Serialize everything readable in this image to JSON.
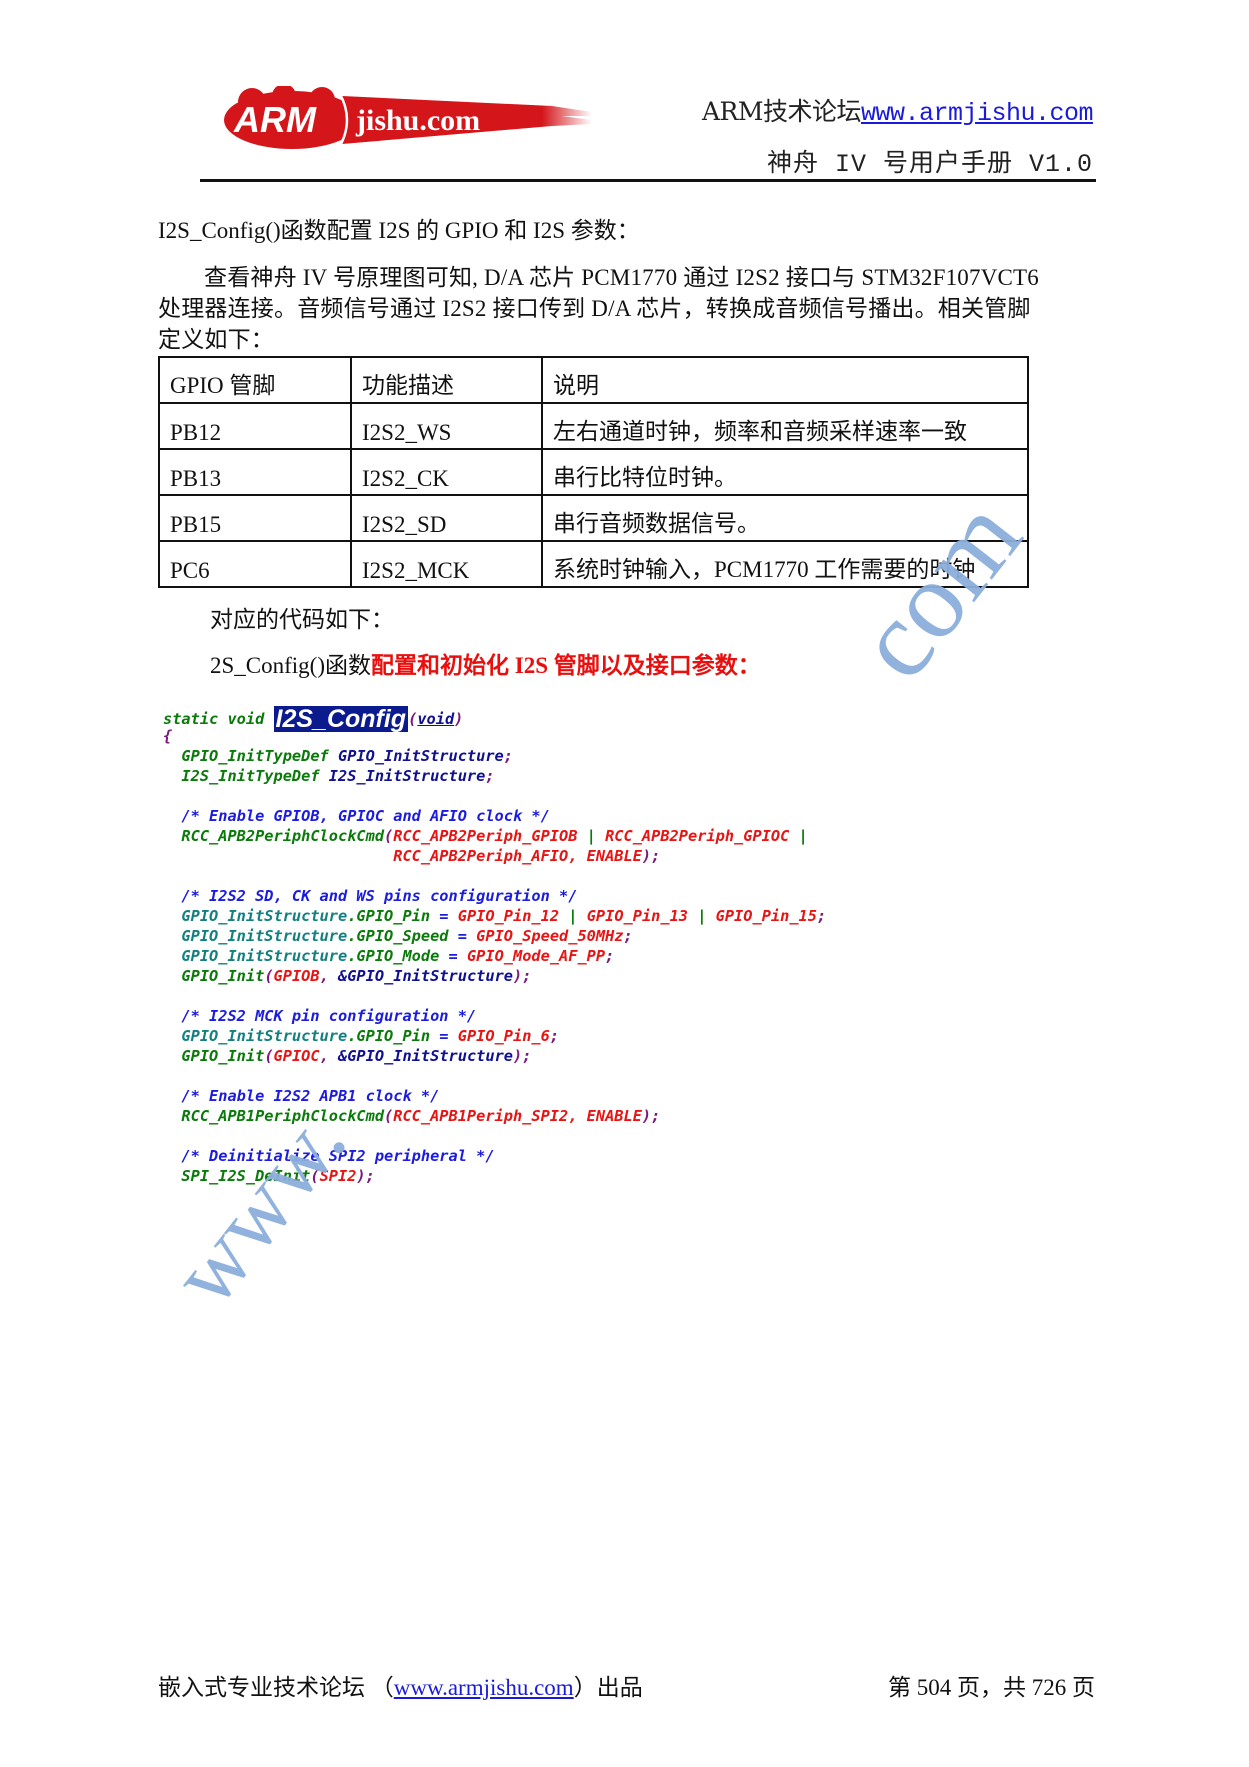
{
  "header": {
    "logo_text_arm": "ARM",
    "logo_text_site": "jishu.com",
    "forum_label": "ARM技术论坛",
    "forum_url": "www.armjishu.com",
    "manual_title": "神舟 IV 号用户手册 V1.0"
  },
  "body": {
    "heading": "I2S_Config()函数配置 I2S 的 GPIO 和 I2S 参数：",
    "intro_lines": [
      "查看神舟 IV 号原理图可知, D/A 芯片 PCM1770 通过 I2S2 接口与 STM32F107VCT6",
      "处理器连接。音频信号通过 I2S2 接口传到 D/A 芯片，转换成音频信号播出。相关管脚",
      "定义如下："
    ],
    "code_intro": "对应的代码如下：",
    "code_caption_plain": "2S_Config()函数",
    "code_caption_red": "配置和初始化 I2S 管脚以及接口参数："
  },
  "table": {
    "headers": [
      "GPIO 管脚",
      "功能描述",
      "说明"
    ],
    "rows": [
      [
        "PB12",
        "I2S2_WS",
        "左右通道时钟，频率和音频采样速率一致"
      ],
      [
        "PB13",
        "I2S2_CK",
        "串行比特位时钟。"
      ],
      [
        "PB15",
        "I2S2_SD",
        "串行音频数据信号。"
      ],
      [
        "PC6",
        "I2S2_MCK",
        "系统时钟输入，PCM1770 工作需要的时钟"
      ]
    ]
  },
  "code": [
    [
      [
        "static void ",
        "green"
      ],
      [
        "I2S_Config",
        "fn"
      ],
      [
        "(",
        "purple"
      ],
      [
        "void",
        "uline"
      ],
      [
        ")",
        "purple"
      ]
    ],
    [
      [
        "{",
        "purple"
      ]
    ],
    [
      [
        "  GPIO_InitTypeDef ",
        "green"
      ],
      [
        "GPIO_InitStructure",
        "navy"
      ],
      [
        ";",
        "purple"
      ]
    ],
    [
      [
        "  I2S_InitTypeDef ",
        "green"
      ],
      [
        "I2S_InitStructure",
        "navy"
      ],
      [
        ";",
        "purple"
      ]
    ],
    [],
    [
      [
        "  /* Enable GPIOB, GPIOC and AFIO clock */",
        "blue"
      ]
    ],
    [
      [
        "  RCC_APB2PeriphClockCmd",
        "green"
      ],
      [
        "(",
        "purple"
      ],
      [
        "RCC_APB2Periph_GPIOB",
        "red"
      ],
      [
        " | ",
        "green"
      ],
      [
        "RCC_APB2Periph_GPIOC",
        "red"
      ],
      [
        " |",
        "green"
      ]
    ],
    [
      [
        "                         ",
        "green"
      ],
      [
        "RCC_APB2Periph_AFIO, ENABLE",
        "red"
      ],
      [
        ");",
        "purple"
      ]
    ],
    [],
    [
      [
        "  /* I2S2 SD, CK and WS pins configuration */",
        "blue"
      ]
    ],
    [
      [
        "  GPIO_InitStructure",
        "teal"
      ],
      [
        ".GPIO_Pin",
        "green"
      ],
      [
        " = ",
        "blue"
      ],
      [
        "GPIO_Pin_12",
        "red"
      ],
      [
        " | ",
        "green"
      ],
      [
        "GPIO_Pin_13",
        "red"
      ],
      [
        " | ",
        "green"
      ],
      [
        "GPIO_Pin_15",
        "red"
      ],
      [
        ";",
        "purple"
      ]
    ],
    [
      [
        "  GPIO_InitStructure",
        "teal"
      ],
      [
        ".GPIO_Speed",
        "green"
      ],
      [
        " = ",
        "blue"
      ],
      [
        "GPIO_Speed_50MHz",
        "red"
      ],
      [
        ";",
        "purple"
      ]
    ],
    [
      [
        "  GPIO_InitStructure",
        "teal"
      ],
      [
        ".GPIO_Mode",
        "green"
      ],
      [
        " = ",
        "blue"
      ],
      [
        "GPIO_Mode_AF_PP",
        "red"
      ],
      [
        ";",
        "purple"
      ]
    ],
    [
      [
        "  GPIO_Init",
        "green"
      ],
      [
        "(",
        "purple"
      ],
      [
        "GPIOB",
        "red"
      ],
      [
        ", ",
        "purple"
      ],
      [
        "&GPIO_InitStructure",
        "navy"
      ],
      [
        ");",
        "purple"
      ]
    ],
    [],
    [
      [
        "  /* I2S2 MCK pin configuration */",
        "blue"
      ]
    ],
    [
      [
        "  GPIO_InitStructure",
        "teal"
      ],
      [
        ".GPIO_Pin",
        "green"
      ],
      [
        " = ",
        "blue"
      ],
      [
        "GPIO_Pin_6",
        "red"
      ],
      [
        ";",
        "purple"
      ]
    ],
    [
      [
        "  GPIO_Init",
        "green"
      ],
      [
        "(",
        "purple"
      ],
      [
        "GPIOC",
        "red"
      ],
      [
        ", ",
        "purple"
      ],
      [
        "&GPIO_InitStructure",
        "navy"
      ],
      [
        ");",
        "purple"
      ]
    ],
    [],
    [
      [
        "  /* Enable I2S2 APB1 clock */",
        "blue"
      ]
    ],
    [
      [
        "  RCC_APB1PeriphClockCmd",
        "green"
      ],
      [
        "(",
        "purple"
      ],
      [
        "RCC_APB1Periph_SPI2, ENABLE",
        "red"
      ],
      [
        ");",
        "purple"
      ]
    ],
    [],
    [
      [
        "  /* Deinitialize SPI2 peripheral */",
        "blue"
      ]
    ],
    [
      [
        "  SPI_I2S_DeInit",
        "green"
      ],
      [
        "(",
        "purple"
      ],
      [
        "SPI2",
        "red"
      ],
      [
        ");",
        "purple"
      ]
    ]
  ],
  "watermark": {
    "left": "www.",
    "right": "com"
  },
  "footer": {
    "left_prefix": "嵌入式专业技术论坛 （",
    "left_url": "www.armjishu.com",
    "left_suffix": "）出品",
    "page_info": "第 504 页，共 726 页",
    "page_current": 504,
    "page_total": 726
  },
  "colors": {
    "logo_red": "#d4161b",
    "link_blue": "#1a1adb",
    "emphasis_red": "#e8100f",
    "watermark_blue": "#8caedb"
  }
}
